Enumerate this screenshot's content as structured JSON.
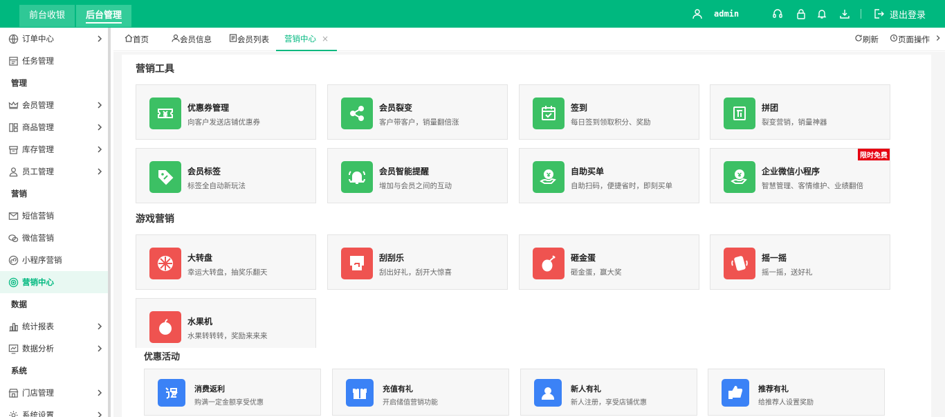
{
  "topbar": {
    "nav_front": "前台收银",
    "nav_back": "后台管理",
    "user": "admin",
    "logout": "退出登录",
    "bg_color": "#00b87f"
  },
  "sidebar": {
    "items": [
      {
        "label": "订单中心",
        "icon": "globe-icon",
        "chevron": true
      },
      {
        "label": "任务管理",
        "icon": "task-icon",
        "chevron": false
      },
      {
        "group": "管理"
      },
      {
        "label": "会员管理",
        "icon": "crown-icon",
        "chevron": true
      },
      {
        "label": "商品管理",
        "icon": "goods-icon",
        "chevron": true
      },
      {
        "label": "库存管理",
        "icon": "stock-icon",
        "chevron": true
      },
      {
        "label": "员工管理",
        "icon": "person-icon",
        "chevron": true
      },
      {
        "group": "营销"
      },
      {
        "label": "短信营销",
        "icon": "mail-icon",
        "chevron": false
      },
      {
        "label": "微信营销",
        "icon": "wechat-icon",
        "chevron": false
      },
      {
        "label": "小程序营销",
        "icon": "miniprogram-icon",
        "chevron": false
      },
      {
        "label": "营销中心",
        "icon": "target-icon",
        "chevron": false,
        "active": true
      },
      {
        "group": "数据"
      },
      {
        "label": "统计报表",
        "icon": "bar-chart-icon",
        "chevron": true
      },
      {
        "label": "数据分析",
        "icon": "analysis-icon",
        "chevron": true
      },
      {
        "group": "系统"
      },
      {
        "label": "门店管理",
        "icon": "store-icon",
        "chevron": true
      },
      {
        "label": "系统设置",
        "icon": "gear-icon",
        "chevron": true
      }
    ]
  },
  "tabs": {
    "home": "首页",
    "member_info": "会员信息",
    "member_list": "会员列表",
    "marketing": "营销中心",
    "close": "×",
    "refresh": "刷新",
    "page_ops": "页面操作"
  },
  "sections": {
    "tools": "营销工具",
    "games": "游戏营销",
    "promos": "优惠活动"
  },
  "tools": [
    {
      "title": "优惠券管理",
      "desc": "向客户发送店铺优惠券",
      "icon": "coupon-icon"
    },
    {
      "title": "会员裂变",
      "desc": "客户带客户，销量翻倍涨",
      "icon": "share-icon"
    },
    {
      "title": "签到",
      "desc": "每日签到领取积分、奖励",
      "icon": "calendar-check-icon"
    },
    {
      "title": "拼团",
      "desc": "裂变营销，销量神器",
      "icon": "group-buy-icon"
    },
    {
      "title": "会员标签",
      "desc": "标签全自动新玩法",
      "icon": "tag-icon"
    },
    {
      "title": "会员智能提醒",
      "desc": "增加与会员之间的互动",
      "icon": "bell-icon"
    },
    {
      "title": "自助买单",
      "desc": "自助扫码，便捷省时，即刻买单",
      "icon": "hand-money-icon"
    },
    {
      "title": "企业微信小程序",
      "desc": "智慧管理、客情维护、业绩翻倍",
      "icon": "hand-money-icon",
      "badge": "限时免费"
    }
  ],
  "games": [
    {
      "title": "大转盘",
      "desc": "幸运大转盘，抽奖乐翻天",
      "icon": "wheel-icon"
    },
    {
      "title": "刮刮乐",
      "desc": "刮出好礼，刮开大惊喜",
      "icon": "scratch-icon"
    },
    {
      "title": "砸金蛋",
      "desc": "砸金蛋，赢大奖",
      "icon": "egg-icon"
    },
    {
      "title": "摇一摇",
      "desc": "摇一摇，送好礼",
      "icon": "shake-icon"
    },
    {
      "title": "水果机",
      "desc": "水果转转转，奖励来来来",
      "icon": "apple-icon"
    }
  ],
  "promos": [
    {
      "title": "消费返利",
      "desc": "购满一定金额享受优惠",
      "icon": "rebate-icon"
    },
    {
      "title": "充值有礼",
      "desc": "开启储值营销功能",
      "icon": "gift-icon"
    },
    {
      "title": "新人有礼",
      "desc": "新人注册，享受店铺优惠",
      "icon": "newuser-icon"
    },
    {
      "title": "推荐有礼",
      "desc": "给推荐人设置奖励",
      "icon": "thumb-up-icon"
    }
  ],
  "colors": {
    "accent": "#00b87f",
    "tool_green": "#3cc064",
    "game_red": "#ef5350",
    "promo_blue": "#3b82f6",
    "badge_red": "#e60012"
  }
}
